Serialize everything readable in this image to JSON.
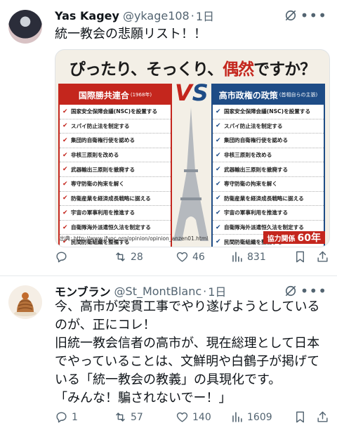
{
  "tweets": [
    {
      "author_name": "Yas Kagey",
      "handle": "@ykage108",
      "separator": "·",
      "time": "1日",
      "text_lines": [
        "統一教会の悲願リスト！！"
      ],
      "media": {
        "title_part1": "ぴったり、そっくり、",
        "title_part2": "偶然",
        "title_part3": "ですか？",
        "vs_v": "V",
        "vs_s": "S",
        "left_heading": "国際勝共連合",
        "left_heading_sub": "(1968年)",
        "right_heading": "高市政権の政策",
        "right_heading_sub": "(首相自らの主張)",
        "left_items": [
          "国家安全保障会議(NSC)を設置する",
          "スパイ防止法を制定する",
          "集団的自衛権行使を認める",
          "非核三原則を改める",
          "武器輸出三原則を撤廃する",
          "専守防衛の拘束を解く",
          "防衛産業を経済成長戦略に据える",
          "宇宙の軍事利用を推進する",
          "自衛隊海外派遣恒久法を制定する",
          "民間防衛組織を整備する"
        ],
        "right_items": [
          "国家安全保障会議(NSC)を設置する",
          "スパイ防止法を制定する",
          "集団的自衛権行使を認める",
          "非核三原則を改める",
          "武器輸出三原則を撤廃する",
          "専守防衛の拘束を解く",
          "防衛産業を経済成長戦略に据える",
          "宇宙の軍事利用を推進する",
          "自衛隊海外派遣恒久法を制定する",
          "民間防衛組織を整備する"
        ],
        "check_mark": "✔",
        "source": "出典: http://www.ifvoc.org/opinion/opinion_anzen01.html",
        "relation_label": "協力関係",
        "relation_years": "60年"
      },
      "replies": "",
      "retweets": "28",
      "likes": "46",
      "views": "831"
    },
    {
      "author_name": "モンブラン",
      "handle": "@St_MontBlanc",
      "separator": "·",
      "time": "1日",
      "text_lines": [
        "今、高市が突貫工事でやり遂げようとしている",
        "のが、正にコレ！",
        "旧統一教会信者の高市が、現在総理として日本",
        "でやっていることは、文鮮明や白鶴子が掲げて",
        "いる「統一教会の教義」の具現化です。",
        "「みんな！騙されないでー！」"
      ],
      "replies": "1",
      "retweets": "57",
      "likes": "140",
      "views": "1609"
    }
  ],
  "colors": {
    "accent_red": "#c4261d",
    "accent_blue": "#1e4c86",
    "icon_gray": "#536471"
  }
}
